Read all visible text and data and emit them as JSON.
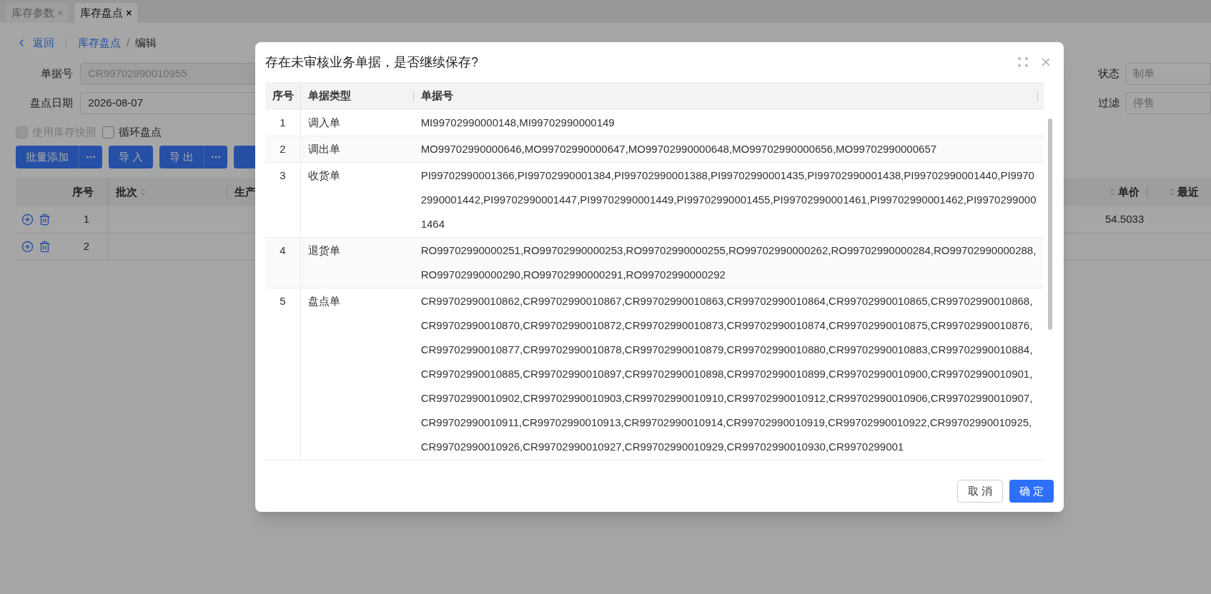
{
  "tabs": [
    {
      "label": "库存参数",
      "close": "×",
      "selected": false
    },
    {
      "label": "库存盘点",
      "close": "×",
      "selected": true
    }
  ],
  "breadcrumb": {
    "back": "返回",
    "parent": "库存盘点",
    "separator": "/",
    "current": "编辑"
  },
  "form": {
    "fields": [
      {
        "label": "单据号",
        "value": "CR99702990010955",
        "disabled": true
      },
      {
        "label": "盘点日期",
        "value": "2026-08-07",
        "disabled": false
      }
    ],
    "right_fields": [
      {
        "label": "状态",
        "placeholder": "制单"
      },
      {
        "label": "过滤",
        "placeholder": "停售"
      }
    ],
    "checkboxes": [
      {
        "label": "使用库存快照",
        "checked": false,
        "disabled": true
      },
      {
        "label": "循环盘点",
        "checked": false,
        "disabled": false
      }
    ]
  },
  "toolbar": [
    {
      "label": "批量添加",
      "has_menu": true
    },
    {
      "label": "导 入",
      "has_menu": false
    },
    {
      "label": "导 出",
      "has_menu": true
    }
  ],
  "table": {
    "columns": [
      {
        "label": "序号",
        "sortable": false
      },
      {
        "label": "批次",
        "sortable": true
      },
      {
        "label": "生产"
      },
      {
        "label": "单价",
        "sortable": true
      },
      {
        "label": "最近",
        "sortable": true
      }
    ],
    "rows": [
      {
        "seq": "1",
        "price": "54.5033"
      },
      {
        "seq": "2"
      }
    ]
  },
  "dialog": {
    "title": "存在未审核业务单据，是否继续保存?",
    "columns": [
      "序号",
      "单据类型",
      "单据号"
    ],
    "rows": [
      {
        "seq": "1",
        "type": "调入单",
        "numbers": "MI99702990000148,MI99702990000149"
      },
      {
        "seq": "2",
        "type": "调出单",
        "numbers": "MO99702990000646,MO99702990000647,MO99702990000648,MO99702990000656,MO99702990000657"
      },
      {
        "seq": "3",
        "type": "收货单",
        "numbers": "PI99702990001366,PI99702990001384,PI99702990001388,PI99702990001435,PI99702990001438,PI99702990001440,PI99702990001442,PI99702990001447,PI99702990001449,PI99702990001455,PI99702990001461,PI99702990001462,PI99702990001464"
      },
      {
        "seq": "4",
        "type": "退货单",
        "numbers": "RO99702990000251,RO99702990000253,RO99702990000255,RO99702990000262,RO99702990000284,RO99702990000288,RO99702990000290,RO99702990000291,RO99702990000292"
      },
      {
        "seq": "5",
        "type": "盘点单",
        "numbers": "CR99702990010862,CR99702990010867,CR99702990010863,CR99702990010864,CR99702990010865,CR99702990010868,CR99702990010870,CR99702990010872,CR99702990010873,CR99702990010874,CR99702990010875,CR99702990010876,CR99702990010877,CR99702990010878,CR99702990010879,CR99702990010880,CR99702990010883,CR99702990010884,CR99702990010885,CR99702990010897,CR99702990010898,CR99702990010899,CR99702990010900,CR99702990010901,CR99702990010902,CR99702990010903,CR99702990010910,CR99702990010912,CR99702990010906,CR99702990010907,CR99702990010911,CR99702990010913,CR99702990010914,CR99702990010919,CR99702990010922,CR99702990010925,CR99702990010926,CR99702990010927,CR99702990010929,CR99702990010930,CR9970299001"
      }
    ],
    "buttons": {
      "cancel": "取 消",
      "confirm": "确 定"
    }
  }
}
